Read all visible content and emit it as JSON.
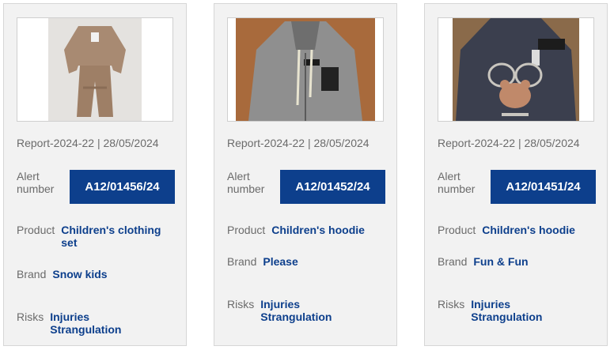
{
  "cards": [
    {
      "image_icon": "childrens-clothing-set-image",
      "report": "Report-2024-22 | 28/05/2024",
      "alert_label": "Alert number",
      "alert_number": "A12/01456/24",
      "product_label": "Product",
      "product_lines": [
        "Children's clothing",
        "set"
      ],
      "brand_label": "Brand",
      "brand": "Snow kids",
      "risks_label": "Risks",
      "risks": [
        "Injuries",
        "Strangulation"
      ]
    },
    {
      "image_icon": "grey-hoodie-image",
      "report": "Report-2024-22 | 28/05/2024",
      "alert_label": "Alert number",
      "alert_number": "A12/01452/24",
      "product_label": "Product",
      "product_lines": [
        "Children's hoodie"
      ],
      "brand_label": "Brand",
      "brand": "Please",
      "risks_label": "Risks",
      "risks": [
        "Injuries",
        "Strangulation"
      ]
    },
    {
      "image_icon": "bear-hoodie-image",
      "report": "Report-2024-22 | 28/05/2024",
      "alert_label": "Alert number",
      "alert_number": "A12/01451/24",
      "product_label": "Product",
      "product_lines": [
        "Children's hoodie"
      ],
      "brand_label": "Brand",
      "brand": "Fun & Fun",
      "risks_label": "Risks",
      "risks": [
        "Injuries",
        "Strangulation"
      ]
    }
  ],
  "colors": {
    "badge": "#0d3f8c",
    "value_text": "#0d3f8c",
    "label_text": "#6b6b6b",
    "card_bg": "#f2f2f2"
  }
}
